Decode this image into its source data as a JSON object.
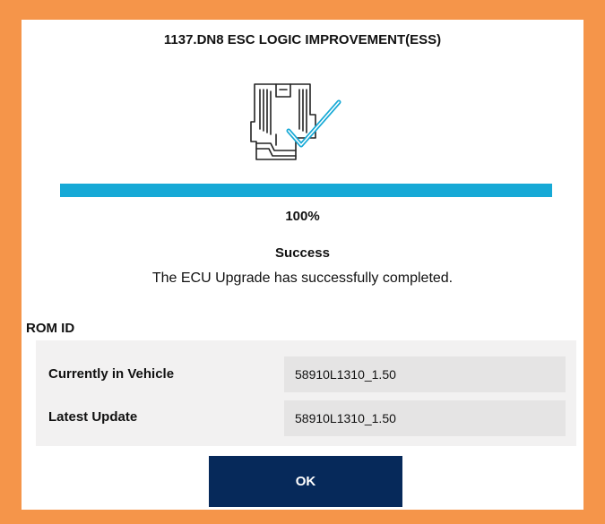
{
  "dialog": {
    "title": "1137.DN8 ESC LOGIC IMPROVEMENT(ESS)",
    "illustration_icon": "ecu-check-icon",
    "progress": {
      "percent": 100,
      "label": "100%",
      "fill_color": "#16A9D6"
    },
    "status": "Success",
    "message": "The ECU Upgrade has successfully completed.",
    "rom": {
      "label": "ROM ID",
      "rows": [
        {
          "label": "Currently in Vehicle",
          "value": "58910L1310_1.50"
        },
        {
          "label": "Latest Update",
          "value": "58910L1310_1.50"
        }
      ]
    },
    "ok_label": "OK"
  },
  "colors": {
    "frame": "#F5954A",
    "accent": "#16A9D6",
    "button": "#06295A"
  }
}
